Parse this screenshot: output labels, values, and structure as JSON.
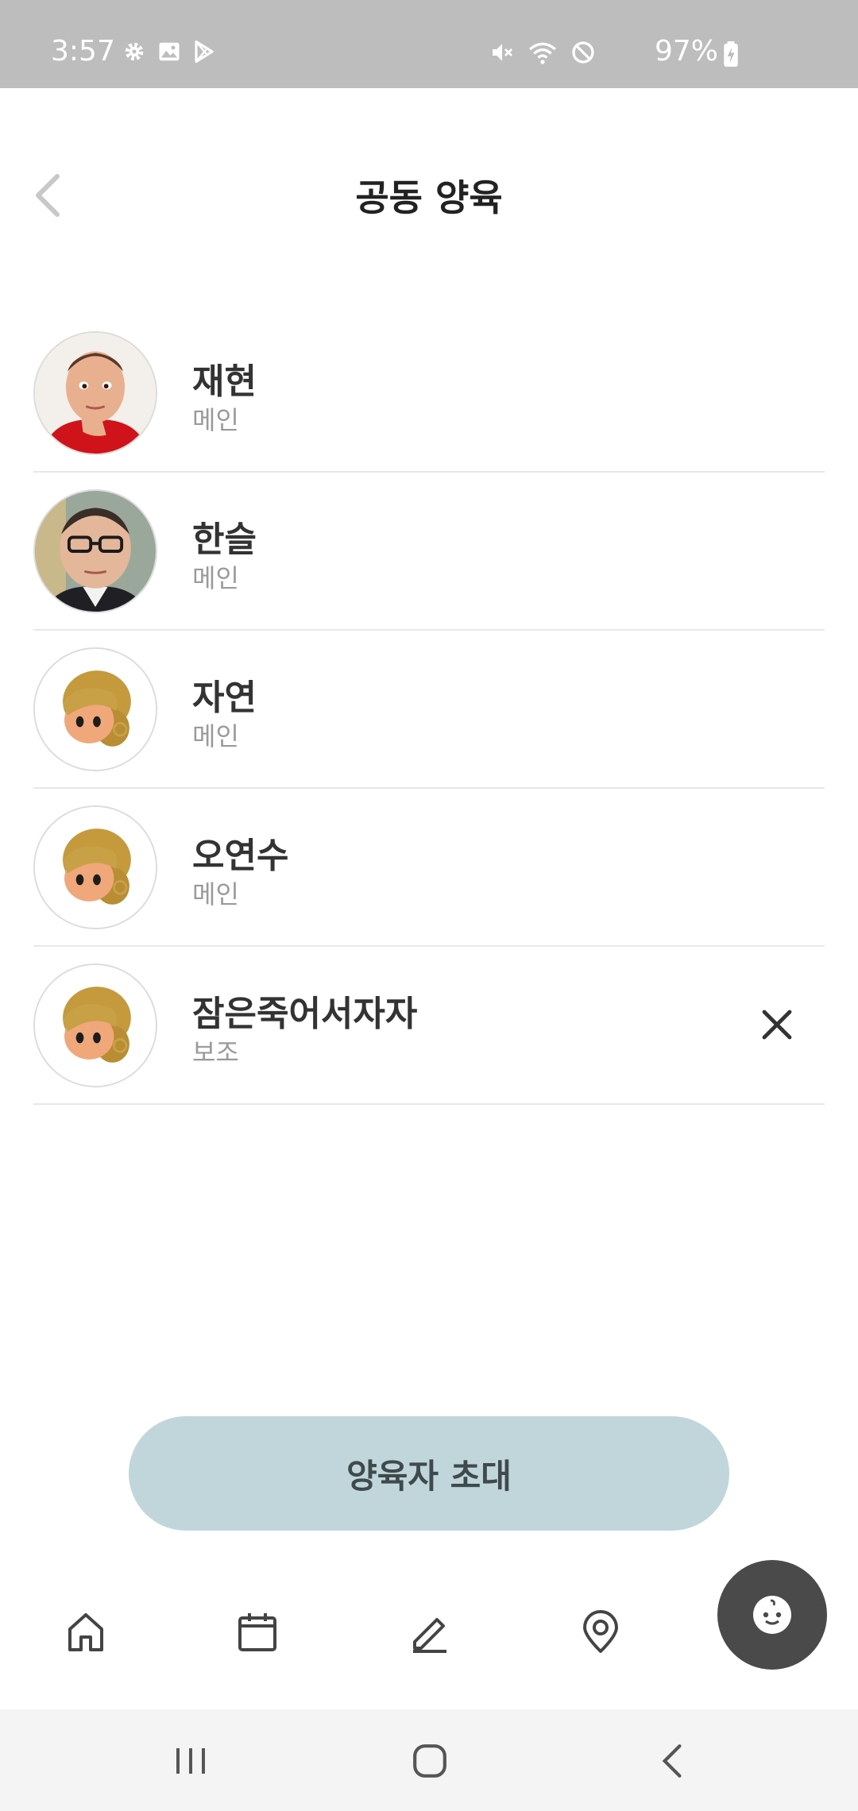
{
  "status_bar": {
    "time": "3:57",
    "battery": "97%",
    "left_icons": [
      "gear-icon",
      "image-icon",
      "play-store-icon"
    ],
    "right_icons": [
      "mute-icon",
      "wifi-icon",
      "block-icon",
      "battery-charging-icon"
    ]
  },
  "header": {
    "title": "공동 양육",
    "back_icon": "chevron-left-icon"
  },
  "members": [
    {
      "name": "재현",
      "role": "메인",
      "avatar": "photo-boy"
    },
    {
      "name": "한슬",
      "role": "메인",
      "avatar": "photo-man-glasses"
    },
    {
      "name": "자연",
      "role": "메인",
      "avatar": "default-avatar"
    },
    {
      "name": "오연수",
      "role": "메인",
      "avatar": "default-avatar"
    },
    {
      "name": "잠은죽어서자자",
      "role": "보조",
      "avatar": "default-avatar",
      "removable": true
    }
  ],
  "invite_button": {
    "label": "양육자 초대"
  },
  "bottom_nav": {
    "items": [
      "home-icon",
      "calendar-icon",
      "pencil-icon",
      "location-pin-icon",
      "baby-icon"
    ],
    "active": "baby-icon"
  },
  "system_nav": [
    "recent-apps-icon",
    "home-circle-icon",
    "back-icon"
  ],
  "colors": {
    "status_bar": "#bdbdbd",
    "invite_button": "#c0d6da",
    "active_nav": "#4a4a4a",
    "divider": "#e8e8e8",
    "role_text": "#9a9a9a"
  }
}
